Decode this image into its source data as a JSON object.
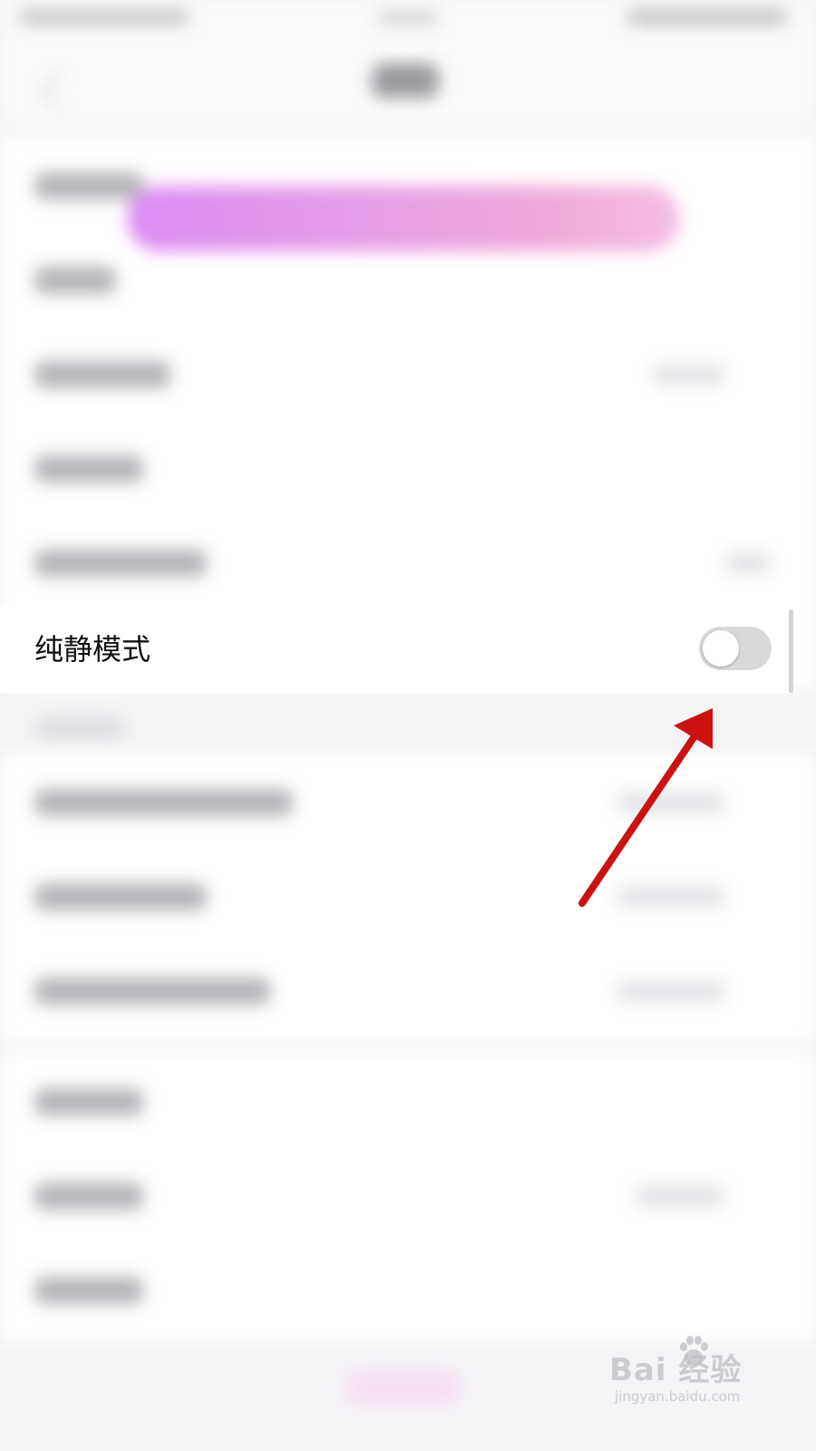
{
  "settings": {
    "focused_row": {
      "label": "纯静模式",
      "toggle_state": "off"
    }
  },
  "annotation": {
    "color": "#cc1111",
    "icon": "arrow-icon"
  },
  "watermark": {
    "main": "Bai 经验",
    "sub": "jingyan.baidu.com",
    "icon": "paw-icon"
  },
  "colors": {
    "banner_start": "#dd8cf5",
    "banner_end": "#f4bde3",
    "toggle_off": "#d9d9d9"
  }
}
